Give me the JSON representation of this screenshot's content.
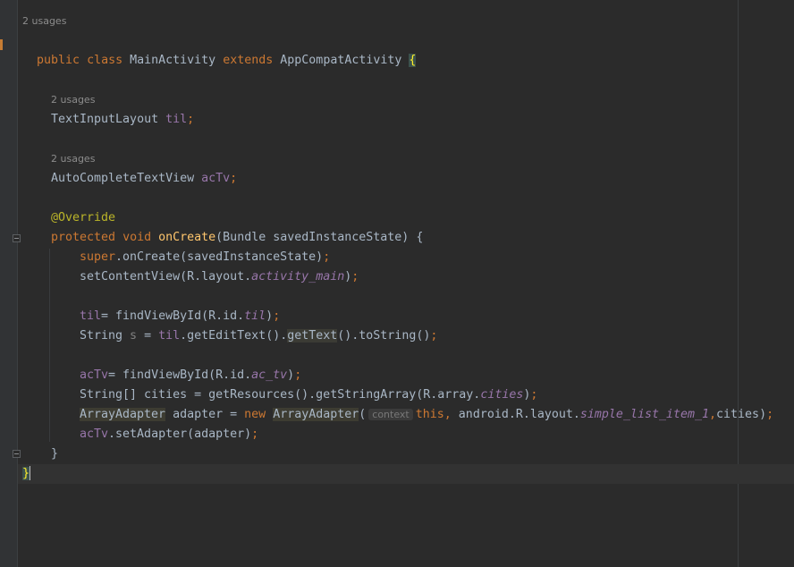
{
  "editor": {
    "usages_hint": "2 usages",
    "param_hint": "context",
    "lines": {
      "l1": {
        "kw1": "public",
        "kw2": "class",
        "name": "MainActivity",
        "kw3": "extends",
        "parent": "AppCompatActivity",
        "brace": "{"
      },
      "l2": {
        "type": "TextInputLayout",
        "var": "til",
        "semi": ";"
      },
      "l3": {
        "type": "AutoCompleteTextView",
        "var": "acTv",
        "semi": ";"
      },
      "l4": {
        "ann": "@Override"
      },
      "l5": {
        "kw1": "protected",
        "kw2": "void",
        "method": "onCreate",
        "rest": "(Bundle savedInstanceState) {"
      },
      "l6": {
        "kw": "super",
        "rest": ".onCreate(savedInstanceState)",
        "semi": ";"
      },
      "l7": {
        "a": "setContentView(R.layout.",
        "b": "activity_main",
        "c": ")",
        "semi": ";"
      },
      "l8": {
        "var": "til",
        "a": "= findViewById(R.id.",
        "b": "til",
        "c": ")",
        "semi": ";"
      },
      "l9": {
        "a": "String ",
        "s": "s",
        "b": " = ",
        "til": "til",
        "c": ".getEditText().",
        "gt": "getText",
        "d": "().toString()",
        "semi": ";"
      },
      "l10": {
        "var": "acTv",
        "a": "= findViewById(R.id.",
        "b": "ac_tv",
        "c": ")",
        "semi": ";"
      },
      "l11": {
        "a": "String[] cities = getResources().getStringArray(R.array.",
        "b": "cities",
        "c": ")",
        "semi": ";"
      },
      "l12": {
        "t1": "ArrayAdapter",
        "a": " adapter = ",
        "kw": "new",
        "sp": " ",
        "t2": "ArrayAdapter",
        "p": "(",
        "this": "this",
        "comma": ",",
        "b": " android.R.layout.",
        "c": "simple_list_item_1",
        "comma2": ",",
        "d": "cities)",
        "semi": ";"
      },
      "l13": {
        "var": "acTv",
        "a": ".setAdapter(adapter)",
        "semi": ";"
      },
      "l14": {
        "brace": "}"
      },
      "l15": {
        "brace": "}"
      }
    }
  }
}
